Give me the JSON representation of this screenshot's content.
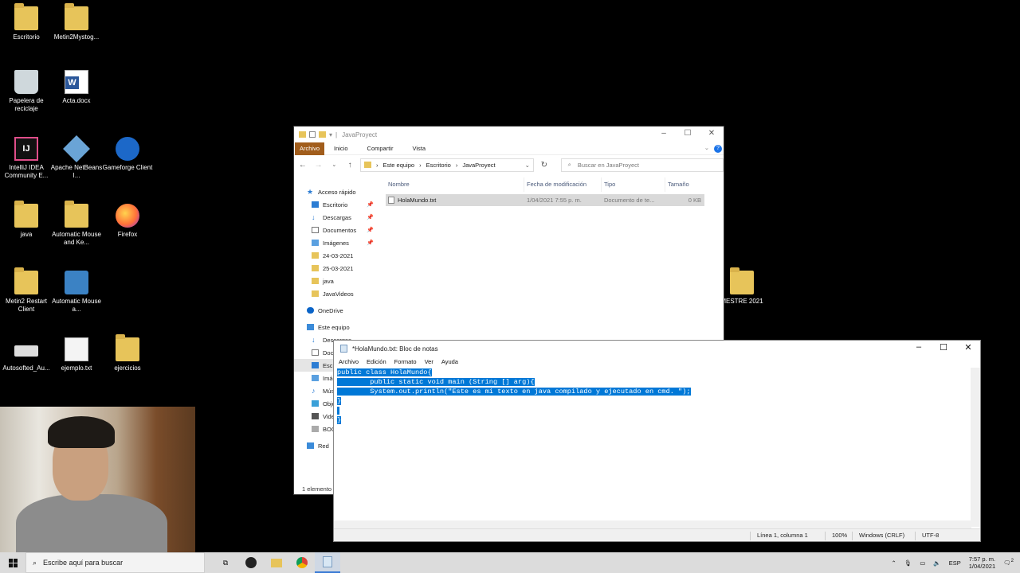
{
  "desktop": {
    "icons": [
      {
        "label": "Escritorio",
        "icon": "folder-icon"
      },
      {
        "label": "Metin2Mystog...",
        "icon": "folder-icon"
      },
      {
        "label": "Papelera de reciclaje",
        "icon": "recycle-bin-icon"
      },
      {
        "label": "Acta.docx",
        "icon": "word-document-icon"
      },
      {
        "label": "IntelliJ IDEA Community E...",
        "icon": "intellij-icon"
      },
      {
        "label": "Apache NetBeans I...",
        "icon": "netbeans-icon"
      },
      {
        "label": "Gameforge Client",
        "icon": "gameforge-icon"
      },
      {
        "label": "java",
        "icon": "folder-icon"
      },
      {
        "label": "Automatic Mouse and Ke...",
        "icon": "folder-icon"
      },
      {
        "label": "Firefox",
        "icon": "firefox-icon"
      },
      {
        "label": "Metin2 Restart Client",
        "icon": "folder-icon"
      },
      {
        "label": "Automatic Mouse a...",
        "icon": "keyboard-mouse-icon"
      },
      {
        "label": "Autosofted_Au...",
        "icon": "keyboard-icon"
      },
      {
        "label": "ejemplo.txt",
        "icon": "text-file-icon"
      },
      {
        "label": "ejercicios",
        "icon": "folder-icon"
      },
      {
        "label": "MESTRE 2021",
        "icon": "folder-icon"
      }
    ]
  },
  "explorer": {
    "title": "JavaProyect",
    "ribbon_tabs": [
      "Archivo",
      "Inicio",
      "Compartir",
      "Vista"
    ],
    "address_parts": [
      "Este equipo",
      "Escritorio",
      "JavaProyect"
    ],
    "search_placeholder": "Buscar en JavaProyect",
    "nav_items": [
      {
        "label": "Acceso rápido",
        "pinned": false
      },
      {
        "label": "Escritorio",
        "pinned": true
      },
      {
        "label": "Descargas",
        "pinned": true
      },
      {
        "label": "Documentos",
        "pinned": true
      },
      {
        "label": "Imágenes",
        "pinned": true
      },
      {
        "label": "24-03-2021",
        "pinned": false
      },
      {
        "label": "25-03-2021",
        "pinned": false
      },
      {
        "label": "java",
        "pinned": false
      },
      {
        "label": "JavaVideos",
        "pinned": false
      },
      {
        "label": "OneDrive",
        "pinned": false
      },
      {
        "label": "Este equipo",
        "pinned": false
      },
      {
        "label": "Descargas",
        "pinned": false
      },
      {
        "label": "Doc",
        "pinned": false
      },
      {
        "label": "Escr",
        "pinned": false
      },
      {
        "label": "Imág",
        "pinned": false
      },
      {
        "label": "Mús",
        "pinned": false
      },
      {
        "label": "Obje",
        "pinned": false
      },
      {
        "label": "Vide",
        "pinned": false
      },
      {
        "label": "BOO",
        "pinned": false
      },
      {
        "label": "Red",
        "pinned": false
      }
    ],
    "columns": [
      "Nombre",
      "Fecha de modificación",
      "Tipo",
      "Tamaño"
    ],
    "files": [
      {
        "name": "HolaMundo.txt",
        "date": "1/04/2021 7:55 p. m.",
        "type": "Documento de te...",
        "size": "0 KB"
      }
    ],
    "status": "1 elemento"
  },
  "notepad": {
    "title": "*HolaMundo.txt: Bloc de notas",
    "menu": [
      "Archivo",
      "Edición",
      "Formato",
      "Ver",
      "Ayuda"
    ],
    "lines": [
      "public class HolaMundo{",
      "        public static void main (String [] arg){",
      "        System.out.println(\"Este es mi texto en java compilado y ejecutado en cmd. \");",
      "}",
      "",
      "}"
    ],
    "status": {
      "position": "Línea 1, columna 1",
      "zoom": "100%",
      "line_ending": "Windows (CRLF)",
      "encoding": "UTF-8"
    }
  },
  "taskbar": {
    "search_placeholder": "Escribe aquí para buscar",
    "language": "ESP",
    "time": "7:57 p. m.",
    "date": "1/04/2021",
    "notification_count": "2"
  }
}
